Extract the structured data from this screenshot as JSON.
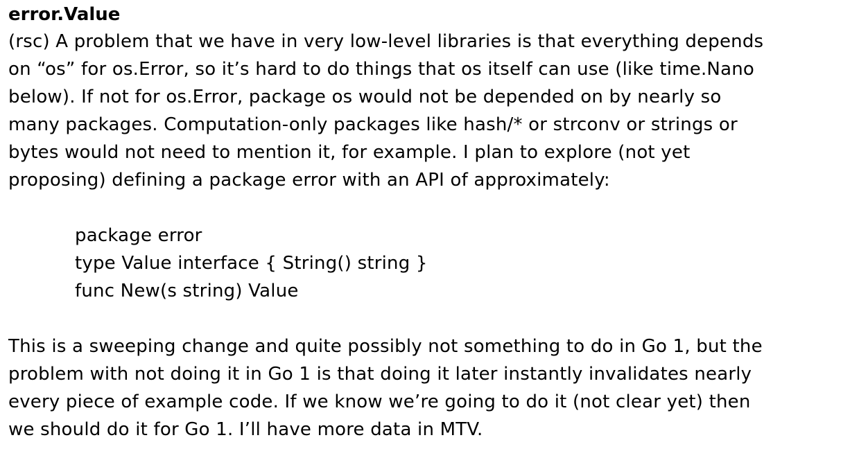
{
  "heading": "error.Value",
  "para1": [
    "(rsc) A problem that we have in very low-level libraries is that everything depends",
    "on “os” for os.Error, so it’s hard to do things that os itself can use (like time.Nano",
    "below).  If not for os.Error, package os would not be depended on by nearly so",
    "many packages.  Computation-only packages like hash/* or strconv or strings or",
    "bytes would not need to mention it, for example.  I plan to explore (not yet",
    "proposing) defining a package error with an API of approximately:"
  ],
  "code": [
    "package error",
    "type Value interface { String() string }",
    "func New(s string) Value"
  ],
  "para2": [
    "This is a sweeping change and quite possibly not something to do in Go 1, but the",
    "problem with not doing it in Go 1 is that doing it later instantly invalidates nearly",
    "every piece of example code.  If we know we’re going to do it (not clear yet) then",
    "we should do it for Go 1.  I’ll have more data in MTV."
  ]
}
